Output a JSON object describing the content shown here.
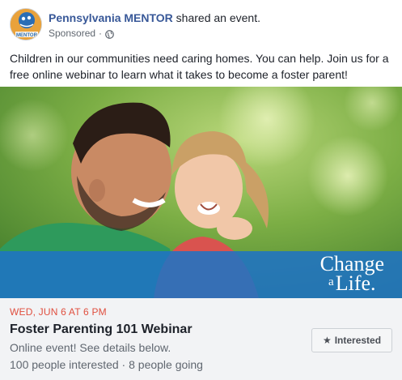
{
  "post": {
    "page_name": "Pennsylvania MENTOR",
    "action": " shared an event.",
    "sponsored": "Sponsored",
    "separator": "·",
    "message": "Children in our communities need caring homes. You can help. Join us for a free online webinar to learn what it takes to become a foster parent!"
  },
  "avatar": {
    "logo_text": "MENTOR",
    "colors": {
      "background": "#e9a23b",
      "badge": "#2a6db5"
    }
  },
  "hero": {
    "tagline_line1": "Change",
    "tagline_small": "a",
    "tagline_line2": "Life."
  },
  "event": {
    "date": "WED, JUN 6 AT 6 PM",
    "title": "Foster Parenting 101 Webinar",
    "subtitle": "Online event! See details below.",
    "stats": "100 people interested · 8 people going",
    "interested_label": "Interested",
    "interested_icon": "star-icon"
  },
  "colors": {
    "link": "#385898",
    "date_red": "#e04f3f",
    "band_blue": "#1f73c4",
    "event_bg": "#f2f3f5"
  }
}
